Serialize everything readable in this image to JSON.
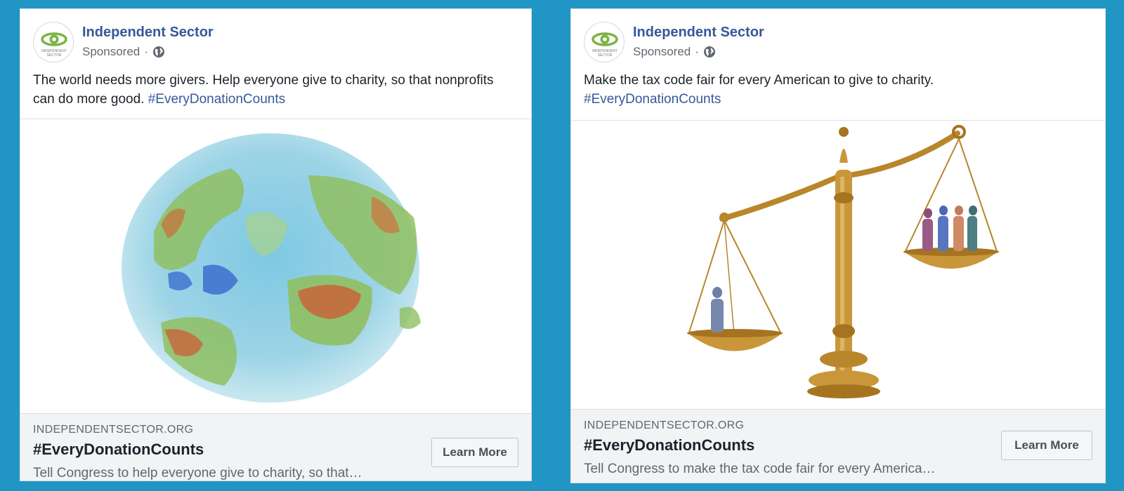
{
  "ads": [
    {
      "page_name": "Independent Sector",
      "sponsored": "Sponsored",
      "separator": "·",
      "logo_text": [
        "INDEPENDENT",
        "SECTOR"
      ],
      "post_text": "The world needs more givers. Help everyone give to charity, so that nonprofits can do more good.",
      "hashtag": "#EveryDonationCounts",
      "link_domain": "INDEPENDENTSECTOR.ORG",
      "link_headline": "#EveryDonationCounts",
      "link_description": "Tell Congress to help everyone give to charity, so that…",
      "cta_label": "Learn More",
      "image": "watercolor-globe"
    },
    {
      "page_name": "Independent Sector",
      "sponsored": "Sponsored",
      "separator": "·",
      "logo_text": [
        "INDEPENDENT",
        "SECTOR"
      ],
      "post_text": "Make the tax code fair for every American to give to charity.",
      "hashtag": "#EveryDonationCounts",
      "link_domain": "INDEPENDENTSECTOR.ORG",
      "link_headline": "#EveryDonationCounts",
      "link_description": "Tell Congress to make the tax code fair for every America…",
      "cta_label": "Learn More",
      "image": "scales-of-justice"
    }
  ],
  "colors": {
    "background": "#2196c4",
    "link": "#365899",
    "logo_green": "#7cb342"
  },
  "icons": [
    "globe-icon"
  ]
}
